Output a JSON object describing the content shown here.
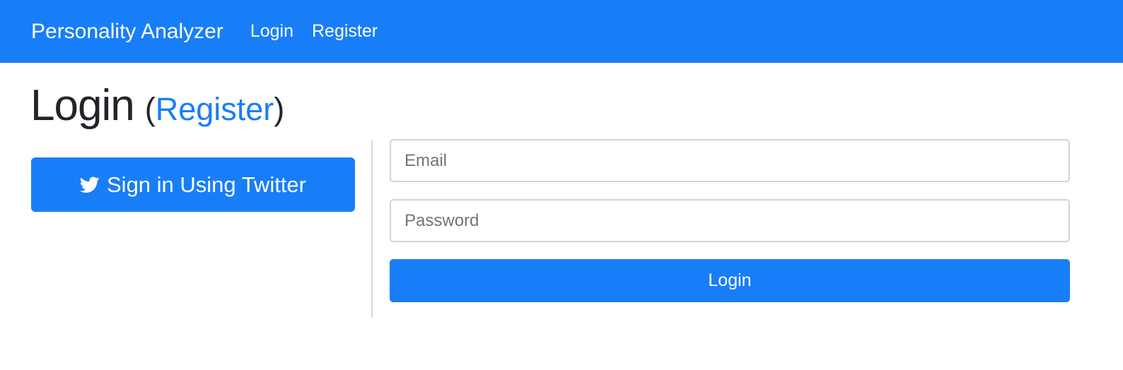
{
  "navbar": {
    "brand": "Personality Analyzer",
    "links": [
      "Login",
      "Register"
    ],
    "background": "#187ef8"
  },
  "heading": {
    "title": "Login",
    "open_paren": "(",
    "register_link": "Register",
    "close_paren": ")"
  },
  "social": {
    "icon": "twitter-icon",
    "label": "Sign in Using Twitter"
  },
  "form": {
    "email_placeholder": "Email",
    "password_placeholder": "Password",
    "submit_label": "Login"
  },
  "colors": {
    "primary": "#187ef8",
    "text": "#212529",
    "input_border": "#ced4da",
    "divider": "#d9d9d9"
  }
}
